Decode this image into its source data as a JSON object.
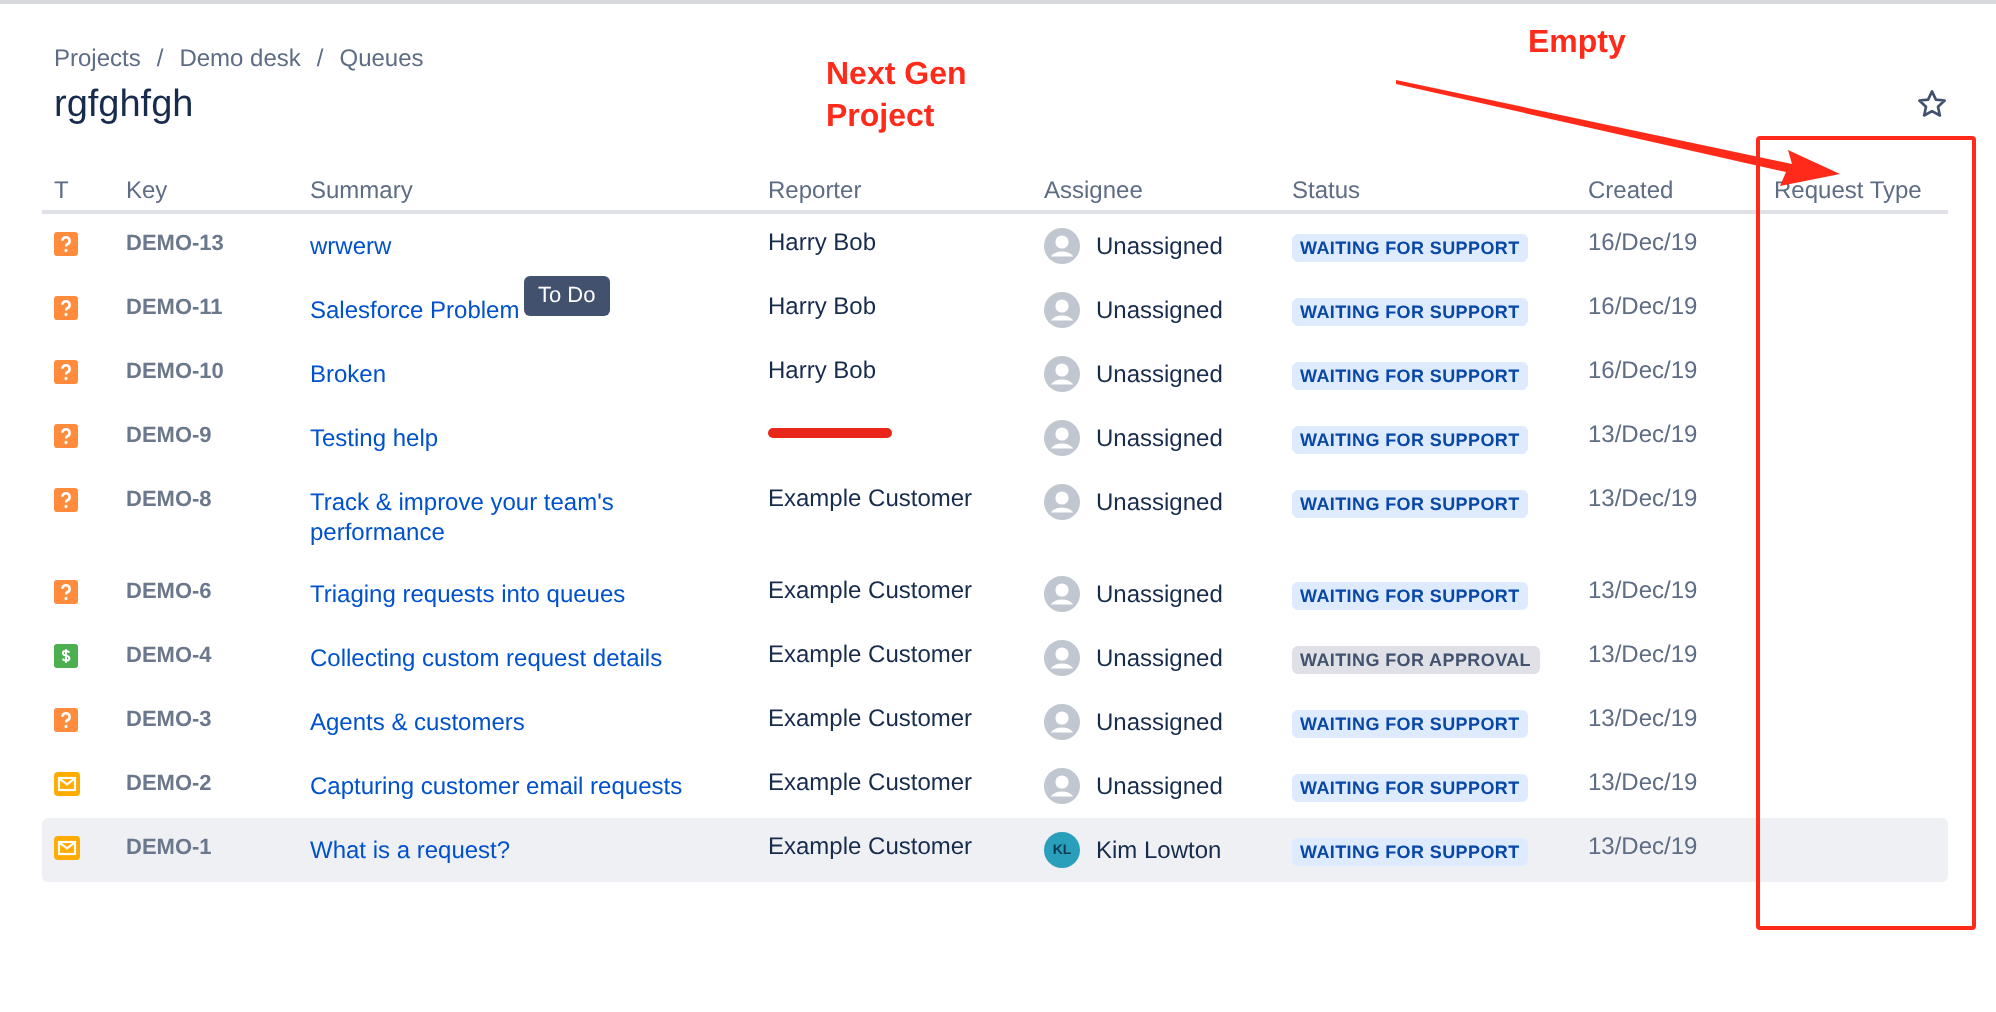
{
  "breadcrumbs": [
    {
      "label": "Projects"
    },
    {
      "separator": "/",
      "label": "Demo desk"
    },
    {
      "separator": "/",
      "label": "Queues"
    }
  ],
  "title": "rgfghfgh",
  "columns": [
    "T",
    "Key",
    "Summary",
    "Reporter",
    "Assignee",
    "Status",
    "Created",
    "Request Type"
  ],
  "rows": [
    {
      "kind": "question",
      "key": "DEMO-13",
      "summary": "wrwerw",
      "reporter": "Harry Bob",
      "reporter_redacted": false,
      "assignee": "Unassigned",
      "initials": "",
      "status": {
        "label": "WAITING FOR SUPPORT",
        "kind": "support"
      },
      "created": "16/Dec/19",
      "selected": false
    },
    {
      "kind": "question",
      "key": "DEMO-11",
      "summary": "Salesforce Problem",
      "tooltip": "To Do",
      "reporter": "Harry Bob",
      "reporter_redacted": false,
      "assignee": "Unassigned",
      "initials": "",
      "status": {
        "label": "WAITING FOR SUPPORT",
        "kind": "support"
      },
      "created": "16/Dec/19",
      "selected": false
    },
    {
      "kind": "question",
      "key": "DEMO-10",
      "summary": "Broken",
      "reporter": "Harry Bob",
      "reporter_redacted": false,
      "assignee": "Unassigned",
      "initials": "",
      "status": {
        "label": "WAITING FOR SUPPORT",
        "kind": "support"
      },
      "created": "16/Dec/19",
      "selected": false
    },
    {
      "kind": "question",
      "key": "DEMO-9",
      "summary": "Testing help",
      "reporter_redacted": true,
      "assignee": "Unassigned",
      "initials": "",
      "status": {
        "label": "WAITING FOR SUPPORT",
        "kind": "support"
      },
      "created": "13/Dec/19",
      "selected": false
    },
    {
      "kind": "question",
      "key": "DEMO-8",
      "summary": "Track & improve your team's performance",
      "reporter": "Example Customer",
      "reporter_redacted": false,
      "assignee": "Unassigned",
      "initials": "",
      "status": {
        "label": "WAITING FOR SUPPORT",
        "kind": "support"
      },
      "created": "13/Dec/19",
      "selected": false
    },
    {
      "kind": "question",
      "key": "DEMO-6",
      "summary": "Triaging requests into queues",
      "reporter": "Example Customer",
      "reporter_redacted": false,
      "assignee": "Unassigned",
      "initials": "",
      "status": {
        "label": "WAITING FOR SUPPORT",
        "kind": "support"
      },
      "created": "13/Dec/19",
      "selected": false
    },
    {
      "kind": "money",
      "key": "DEMO-4",
      "summary": "Collecting custom request details",
      "reporter": "Example Customer",
      "reporter_redacted": false,
      "assignee": "Unassigned",
      "initials": "",
      "status": {
        "label": "WAITING FOR APPROVAL",
        "kind": "approval"
      },
      "created": "13/Dec/19",
      "selected": false
    },
    {
      "kind": "question",
      "key": "DEMO-3",
      "summary": "Agents & customers",
      "reporter": "Example Customer",
      "reporter_redacted": false,
      "assignee": "Unassigned",
      "initials": "",
      "status": {
        "label": "WAITING FOR SUPPORT",
        "kind": "support"
      },
      "created": "13/Dec/19",
      "selected": false
    },
    {
      "kind": "email",
      "key": "DEMO-2",
      "summary": "Capturing customer email requests",
      "reporter": "Example Customer",
      "reporter_redacted": false,
      "assignee": "Unassigned",
      "initials": "",
      "status": {
        "label": "WAITING FOR SUPPORT",
        "kind": "support"
      },
      "created": "13/Dec/19",
      "selected": false
    },
    {
      "kind": "email",
      "key": "DEMO-1",
      "summary": "What is a request?",
      "reporter": "Example Customer",
      "reporter_redacted": false,
      "assignee": "Kim Lowton",
      "initials": "KL",
      "status": {
        "label": "WAITING FOR SUPPORT",
        "kind": "support"
      },
      "created": "13/Dec/19",
      "selected": true
    }
  ],
  "annotations": [
    "Next Gen Project",
    "Empty"
  ]
}
